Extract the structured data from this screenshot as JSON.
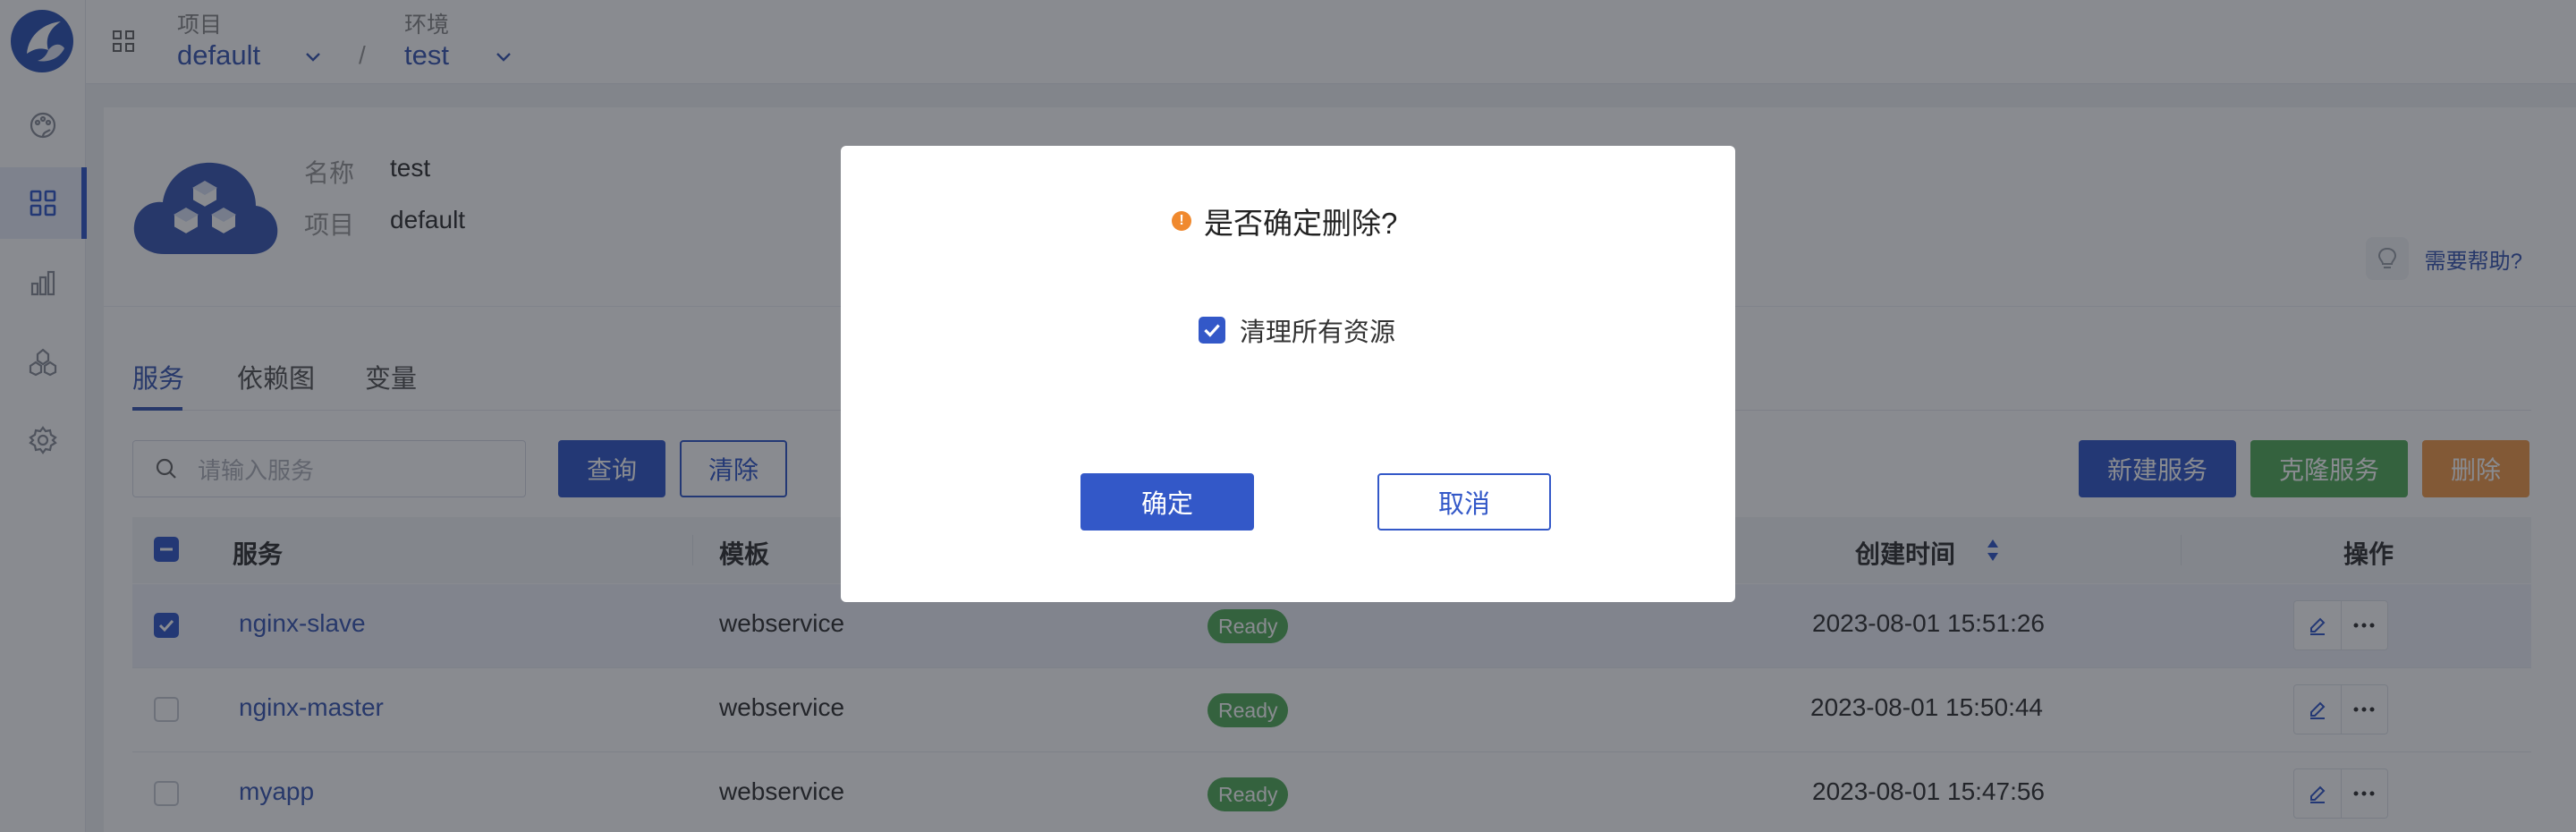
{
  "topbar": {
    "project_label": "项目",
    "project_value": "default",
    "env_label": "环境",
    "env_value": "test",
    "separator": "/"
  },
  "sidebar": {
    "items": [
      {
        "icon": "palette-icon"
      },
      {
        "icon": "grid-icon",
        "active": true
      },
      {
        "icon": "bar-chart-icon"
      },
      {
        "icon": "cluster-icon"
      },
      {
        "icon": "gear-icon"
      }
    ]
  },
  "info": {
    "name_label": "名称",
    "name_value": "test",
    "project_label": "项目",
    "project_value": "default",
    "help": "需要帮助?"
  },
  "tabs": [
    "服务",
    "依赖图",
    "变量"
  ],
  "toolbar": {
    "search_placeholder": "请输入服务",
    "query": "查询",
    "clear": "清除",
    "new_service": "新建服务",
    "clone_service": "克隆服务",
    "delete": "删除"
  },
  "table": {
    "headers": {
      "service": "服务",
      "template": "模板",
      "created": "创建时间",
      "actions": "操作"
    },
    "rows": [
      {
        "name": "nginx-slave",
        "template": "webservice",
        "status": "Ready",
        "created": "2023-08-01 15:51:26",
        "checked": true
      },
      {
        "name": "nginx-master",
        "template": "webservice",
        "status": "Ready",
        "created": "2023-08-01 15:50:44",
        "checked": false
      },
      {
        "name": "myapp",
        "template": "webservice",
        "status": "Ready",
        "created": "2023-08-01 15:47:56",
        "checked": false
      }
    ]
  },
  "modal": {
    "title": "是否确定删除?",
    "checkbox_label": "清理所有资源",
    "checkbox_checked": true,
    "confirm": "确定",
    "cancel": "取消"
  },
  "colors": {
    "primary": "#3358c8",
    "green": "#55ad5b",
    "orange": "#f19a4b",
    "warning": "#f0892e"
  }
}
